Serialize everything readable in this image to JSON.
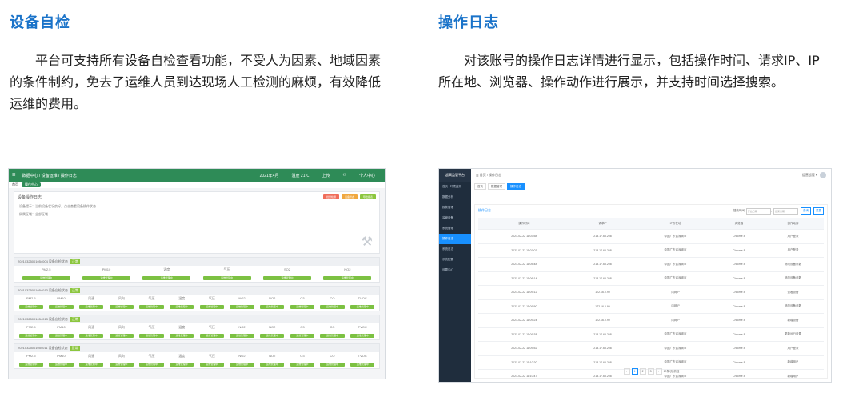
{
  "left": {
    "heading": "设备自检",
    "paragraph": "平台可支持所有设备自检查看功能，不受人为因素、地域因素的条件制约，免去了运维人员到达现场人工检测的麻烦，有效降低运维的费用。",
    "shot": {
      "breadcrumb": "数据中心 / 设备运维 / 操作日志",
      "tb_items": [
        "2021年4月",
        "温度 21℃",
        "上传",
        "个人中心"
      ],
      "tab_label": "操作中心",
      "panel_title": "设备操作日志",
      "panel_buttons": [
        "批量检测",
        "设备状态",
        "导出报表"
      ],
      "panel_line1": "设备提示：当前设备状况良好，点击查看设备操作状态",
      "panel_line2": "所属区域：全部区域",
      "groups": [
        {
          "title": "20210325001054004 设备自检状态",
          "tag": "正常",
          "cols": [
            "PM2.5",
            "PM10",
            "温度",
            "气压",
            "SO2",
            "NO2"
          ],
          "btn": "运维管理中"
        },
        {
          "title": "20210325001054013 设备自检状态",
          "tag": "正常",
          "cols": [
            "PM2.5",
            "PM10",
            "风速",
            "风向",
            "气压",
            "温度",
            "气压",
            "NO2",
            "NO2",
            "O3",
            "CO",
            "TVOC"
          ],
          "btn": "运维管理中"
        },
        {
          "title": "20210325001054013 设备自检状态",
          "tag": "正常",
          "cols": [
            "PM2.5",
            "PM10",
            "风速",
            "风向",
            "气压",
            "温度",
            "气压",
            "NO2",
            "NO2",
            "O3",
            "CO",
            "TVOC"
          ],
          "btn": "运维管理中"
        },
        {
          "title": "20210325001054011 设备自检状态",
          "tag": "正常",
          "cols": [
            "PM2.5",
            "PM10",
            "风速",
            "风向",
            "气压",
            "温度",
            "气压",
            "NO2",
            "NO2",
            "O3",
            "CO",
            "TVOC"
          ],
          "btn": "运维管理中"
        }
      ]
    }
  },
  "right": {
    "heading": "操作日志",
    "paragraph": "对该账号的操作日志详情进行显示，包括操作时间、请求IP、IP所在地、浏览器、操作动作进行展示，并支持时间选择搜索。",
    "shot": {
      "brand": "超高监管平台",
      "side_items": [
        "首页 / 环境监测",
        "数据分析",
        "报警管理",
        "监管设备",
        "系统管理",
        "操作日志",
        "系统日志",
        "系统配置",
        "设置中心"
      ],
      "side_active": 5,
      "breadcrumb": "首页 / 操作日志",
      "user": "运营超管 ▾",
      "tabs": [
        "首页",
        "数据管理",
        "操作日志"
      ],
      "card_title": "操作日志",
      "filter_label": "搜索时间",
      "date_from": "开始日期",
      "date_to": "结束日期",
      "btn_search": "查询",
      "btn_reset": "重置",
      "columns": [
        "操作时间",
        "请求IP",
        "IP所在地",
        "浏览器",
        "操作动作"
      ],
      "rows": [
        [
          "2021-02-22 11:03:58",
          "218.17.63.208",
          "中国广东省深圳市",
          "Chrome 8",
          "用户登录"
        ],
        [
          "2021-02-22 11:07:07",
          "218.17.63.208",
          "中国广东省深圳市",
          "Chrome 8",
          "用户登录"
        ],
        [
          "2021-02-22 11:05:48",
          "218.17.63.208",
          "中国广东省深圳市",
          "Chrome 8",
          "修改设备参数"
        ],
        [
          "2021-02-22 11:06:14",
          "218.17.63.208",
          "中国广东省深圳市",
          "Chrome 8",
          "修改设备参数"
        ],
        [
          "2021-02-22 11:09:12",
          "172.16.0.99",
          "内网IP",
          "Chrome 8",
          "查看设备"
        ],
        [
          "2021-02-22 11:09:50",
          "172.16.0.99",
          "内网IP",
          "Chrome 8",
          "修改设备参数"
        ],
        [
          "2021-02-22 11:09:24",
          "172.16.0.99",
          "内网IP",
          "Chrome 8",
          "新增设备"
        ],
        [
          "2021-02-22 11:09:38",
          "218.17.63.208",
          "中国广东省深圳市",
          "Chrome 8",
          "更新运行设置"
        ],
        [
          "2021-02-22 11:09:52",
          "218.17.63.208",
          "中国广东省深圳市",
          "Chrome 8",
          "用户登录"
        ],
        [
          "2021-02-22 11:10:20",
          "218.17.63.208",
          "中国广东省深圳市",
          "Chrome 8",
          "新增用户"
        ],
        [
          "2021-02-22 11:10:47",
          "218.17.63.208",
          "中国广东省深圳市",
          "Chrome 8",
          "新增用户"
        ]
      ],
      "pager": {
        "pages": [
          "1",
          "2",
          "3"
        ],
        "active": 0,
        "size": "10条/页",
        "goto": "前往"
      }
    }
  }
}
